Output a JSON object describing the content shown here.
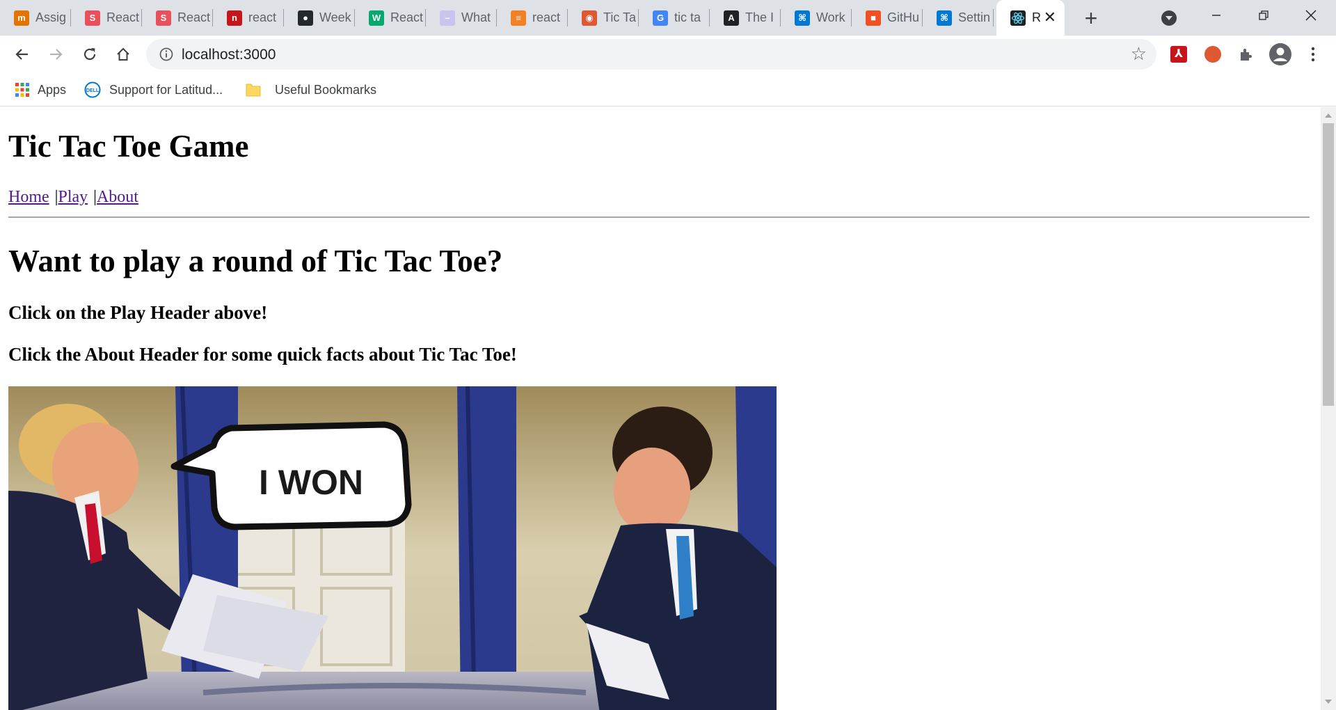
{
  "browser": {
    "tabs": [
      {
        "title": "Assig",
        "icon": "mindtap-icon",
        "color": "#e37400",
        "glyph": "m"
      },
      {
        "title": "React",
        "icon": "s-logo-icon",
        "color": "#e8505b",
        "glyph": "S"
      },
      {
        "title": "React",
        "icon": "s-logo-icon",
        "color": "#e8505b",
        "glyph": "S"
      },
      {
        "title": "react",
        "icon": "n-logo-icon",
        "color": "#c4161c",
        "glyph": "n"
      },
      {
        "title": "Week",
        "icon": "github-icon",
        "color": "#24292e",
        "glyph": "●"
      },
      {
        "title": "React",
        "icon": "w3-icon",
        "color": "#04aa6d",
        "glyph": "W"
      },
      {
        "title": "What",
        "icon": "page-icon",
        "color": "#c9c3f0",
        "glyph": "–"
      },
      {
        "title": "react",
        "icon": "stackoverflow-icon",
        "color": "#f48024",
        "glyph": "≡"
      },
      {
        "title": "Tic Ta",
        "icon": "duckduckgo-icon",
        "color": "#de5833",
        "glyph": "◉"
      },
      {
        "title": "tic ta",
        "icon": "google-icon",
        "color": "#4285f4",
        "glyph": "G"
      },
      {
        "title": "The I",
        "icon": "atlassian-icon",
        "color": "#202124",
        "glyph": "A"
      },
      {
        "title": "Work",
        "icon": "vscode-icon",
        "color": "#0078d4",
        "glyph": "⌘"
      },
      {
        "title": "GitHu",
        "icon": "microsoft-icon",
        "color": "#f25022",
        "glyph": "■"
      },
      {
        "title": "Settin",
        "icon": "vscode-icon",
        "color": "#0078d4",
        "glyph": "⌘"
      }
    ],
    "active_tab": {
      "title": "R",
      "icon": "react-icon"
    },
    "url": "localhost:3000",
    "bookmarks": {
      "apps": "Apps",
      "support": "Support for Latitud...",
      "folder": "Useful Bookmarks"
    }
  },
  "page": {
    "title": "Tic Tac Toe Game",
    "nav": {
      "home": "Home",
      "sep1": "|",
      "play": "Play",
      "sep2": "|",
      "about": "About"
    },
    "heading": "Want to play a round of Tic Tac Toe?",
    "line1": "Click on the Play Header above!",
    "line2": "Click the About Header for some quick facts about Tic Tac Toe!",
    "meme_text": "I WON"
  }
}
